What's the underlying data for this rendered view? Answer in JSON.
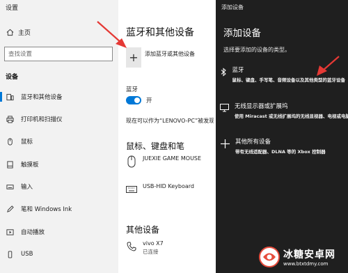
{
  "settings": {
    "window_title": "设置",
    "home_label": "主页",
    "search_placeholder": "查找设置",
    "section_label": "设备",
    "nav_items": [
      {
        "label": "蓝牙和其他设备",
        "icon": "bluetooth-devices-icon"
      },
      {
        "label": "打印机和扫描仪",
        "icon": "printer-icon"
      },
      {
        "label": "鼠标",
        "icon": "mouse-icon"
      },
      {
        "label": "触摸板",
        "icon": "touchpad-icon"
      },
      {
        "label": "输入",
        "icon": "keyboard-icon"
      },
      {
        "label": "笔和 Windows Ink",
        "icon": "pen-icon"
      },
      {
        "label": "自动播放",
        "icon": "autoplay-icon"
      },
      {
        "label": "USB",
        "icon": "usb-icon"
      }
    ]
  },
  "main": {
    "heading": "蓝牙和其他设备",
    "add_device_label": "添加蓝牙或其他设备",
    "bluetooth_label": "蓝牙",
    "toggle_state": "开",
    "discoverable_text": "现在可以作为“LENOVO-PC”被发现",
    "mouse_section": "鼠标、键盘和笔",
    "devices": [
      {
        "name": "JUEXIE GAME MOUSE",
        "icon": "mouse-icon"
      },
      {
        "name": "USB-HID Keyboard",
        "icon": "keyboard-icon"
      }
    ],
    "other_section": "其他设备",
    "other_device": {
      "name": "vivo X7",
      "status": "已连接",
      "icon": "phone-icon"
    }
  },
  "dialog": {
    "title": "添加设备",
    "heading": "添加设备",
    "subheading": "选择要添加的设备的类型。",
    "options": [
      {
        "title": "蓝牙",
        "desc": "鼠标、键盘、手写笔、音频设备以及其他类型的蓝牙设备",
        "icon": "bluetooth-icon"
      },
      {
        "title": "无线显示器或扩展坞",
        "desc": "使用 Miracast 或无线扩展坞的无线显视器、电视或电脑",
        "icon": "monitor-icon"
      },
      {
        "title": "其他所有设备",
        "desc": "带有无线适配器、DLNA 等的 Xbox 控制器",
        "icon": "plus-icon"
      }
    ]
  },
  "watermark": {
    "name": "冰糖安卓网",
    "url": "www.btxtdmy.com"
  },
  "colors": {
    "accent": "#0078d7",
    "dialog_bg": "#1f1f1f",
    "sidebar_bg": "#f2f2f2",
    "annotation": "#e53935"
  }
}
